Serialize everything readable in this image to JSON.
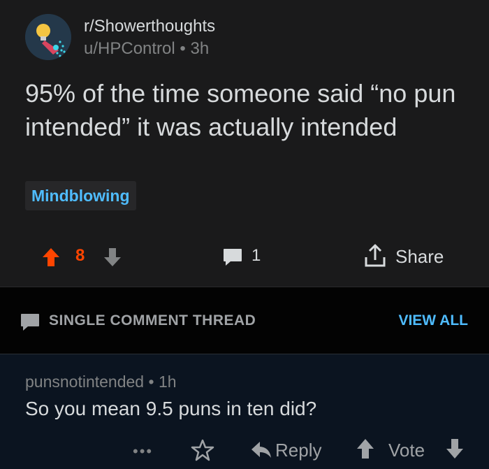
{
  "post": {
    "subreddit": "r/Showerthoughts",
    "author": "u/HPControl",
    "separator": "•",
    "age": "3h",
    "title": "95% of the time someone said “no pun intended” it was actually intended",
    "flair": "Mindblowing",
    "score": "8",
    "comment_count": "1",
    "share_label": "Share",
    "icons": [
      "subreddit-avatar-icon",
      "upvote-icon",
      "downvote-icon",
      "comment-icon",
      "share-icon"
    ]
  },
  "thread_bar": {
    "label": "SINGLE COMMENT THREAD",
    "view_all": "VIEW ALL"
  },
  "comment": {
    "author": "punsnotintended",
    "separator": "•",
    "age": "1h",
    "body": "So you mean 9.5 puns in ten did?",
    "more": "•••",
    "reply_label": "Reply",
    "vote_label": "Vote"
  },
  "colors": {
    "background": "#1a1a1b",
    "thread_bar": "#030303",
    "comment_bg": "#0b1420",
    "upvote": "#ff4500",
    "link": "#4fbcff",
    "text": "#d7dadc",
    "muted": "#818384"
  }
}
